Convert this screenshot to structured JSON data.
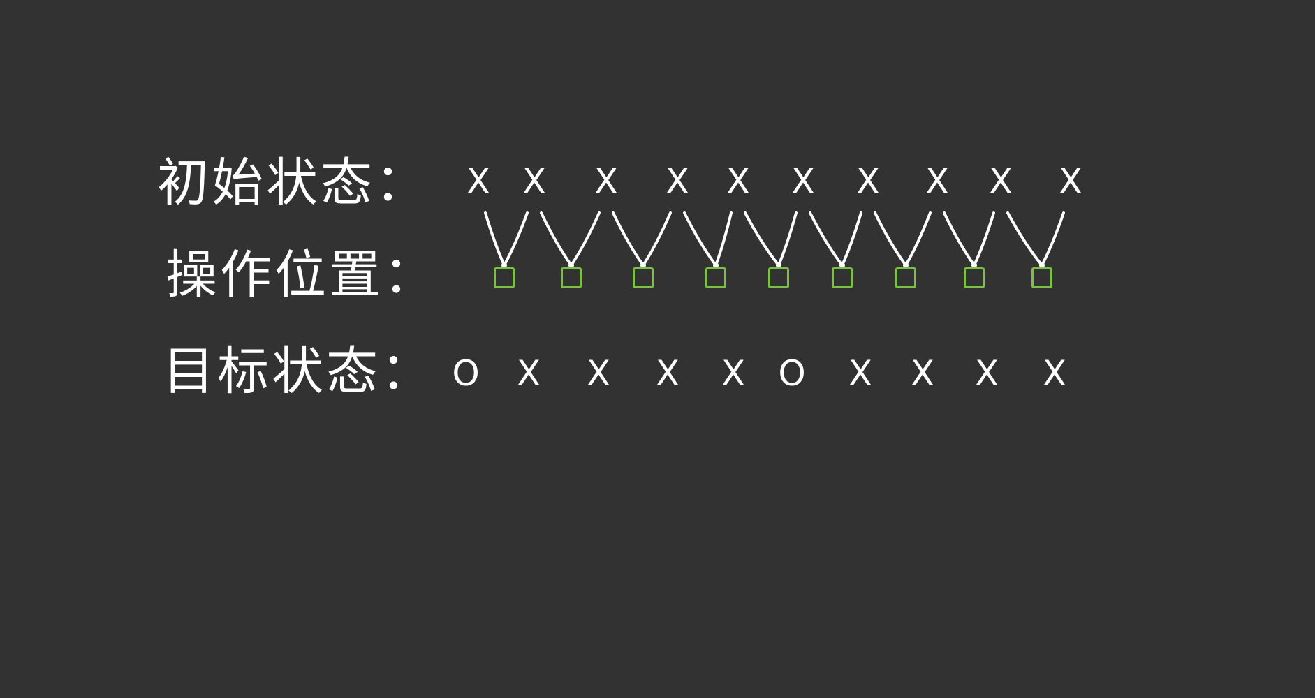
{
  "rows": {
    "initial": {
      "label": "初始状态：",
      "symbols": [
        "X",
        "X",
        "X",
        "X",
        "X",
        "X",
        "X",
        "X",
        "X",
        "X"
      ]
    },
    "operation": {
      "label": "操作位置：",
      "count": 9
    },
    "target": {
      "label": "目标状态：",
      "symbols": [
        "O",
        "X",
        "X",
        "X",
        "X",
        "O",
        "X",
        "X",
        "X",
        "X"
      ]
    }
  },
  "colors": {
    "background": "#323232",
    "grid": "#525252",
    "ink": "#ffffff",
    "marker": "#7cc242"
  }
}
